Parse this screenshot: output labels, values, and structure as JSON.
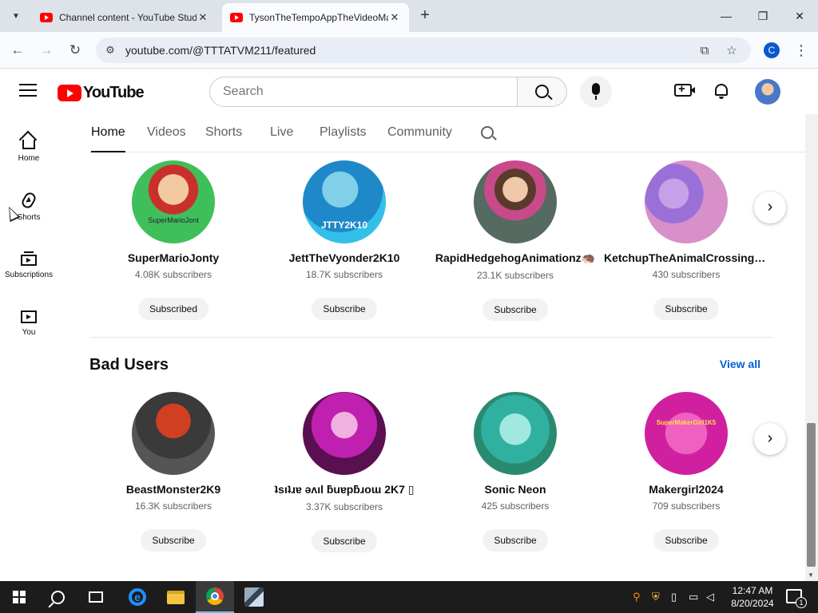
{
  "browser": {
    "tabs": [
      {
        "title": "Channel content - YouTube Studio",
        "active": false
      },
      {
        "title": "TysonTheTempoAppTheVideoMaker - YouTube",
        "active": true
      }
    ],
    "new_tab_icon": "plus-icon",
    "window_controls": [
      "minimize-icon",
      "restore-icon",
      "close-icon"
    ],
    "url": "youtube.com/@TTTATVM211/featured",
    "profile_initial": "C"
  },
  "youtube": {
    "logo_text": "YouTube",
    "search_placeholder": "Search",
    "guide": [
      {
        "label": "Home",
        "icon": "home-icon"
      },
      {
        "label": "Shorts",
        "icon": "shorts-icon"
      },
      {
        "label": "Subscriptions",
        "icon": "subscriptions-icon"
      },
      {
        "label": "You",
        "icon": "you-icon"
      }
    ],
    "channel_tabs": [
      "Home",
      "Videos",
      "Shorts",
      "Live",
      "Playlists",
      "Community"
    ],
    "active_tab": "Home",
    "shelf1": {
      "channels": [
        {
          "name": "SuperMarioJonty",
          "subscribers": "4.08K subscribers",
          "button": "Subscribed",
          "avatar_text": "SuperMarioJont"
        },
        {
          "name": "JettTheVyonder2K10",
          "subscribers": "18.7K subscribers",
          "button": "Subscribe",
          "avatar_text": "JTTY2K10"
        },
        {
          "name": "RapidHedgehogAnimationz🦔",
          "subscribers": "23.1K subscribers",
          "button": "Subscribe",
          "avatar_text": ""
        },
        {
          "name": "KetchupTheAnimalCrossingLu...",
          "subscribers": "430 subscribers",
          "button": "Subscribe",
          "avatar_text": ""
        }
      ]
    },
    "shelf2": {
      "title": "Bad Users",
      "view_all": "View all",
      "channels": [
        {
          "name": "BeastMonster2K9",
          "subscribers": "16.3K subscribers",
          "button": "Subscribe",
          "avatar_text": ""
        },
        {
          "name": "ʇsıʇɹɐ ǝʌıl ƃuɐpƃɹoɯ 2K7 ▯",
          "subscribers": "3.37K subscribers",
          "button": "Subscribe",
          "avatar_text": ""
        },
        {
          "name": "Sonic Neon",
          "subscribers": "425 subscribers",
          "button": "Subscribe",
          "avatar_text": ""
        },
        {
          "name": "Makergirl2024",
          "subscribers": "709 subscribers",
          "button": "Subscribe",
          "avatar_text": "SuperMakerGirl1K5"
        }
      ]
    }
  },
  "taskbar": {
    "time": "12:47 AM",
    "date": "8/20/2024",
    "notification_count": "1"
  },
  "colors": {
    "youtube_red": "#ff0000",
    "link_blue": "#065fd4",
    "taskbar_bg": "#1c1c1c"
  }
}
